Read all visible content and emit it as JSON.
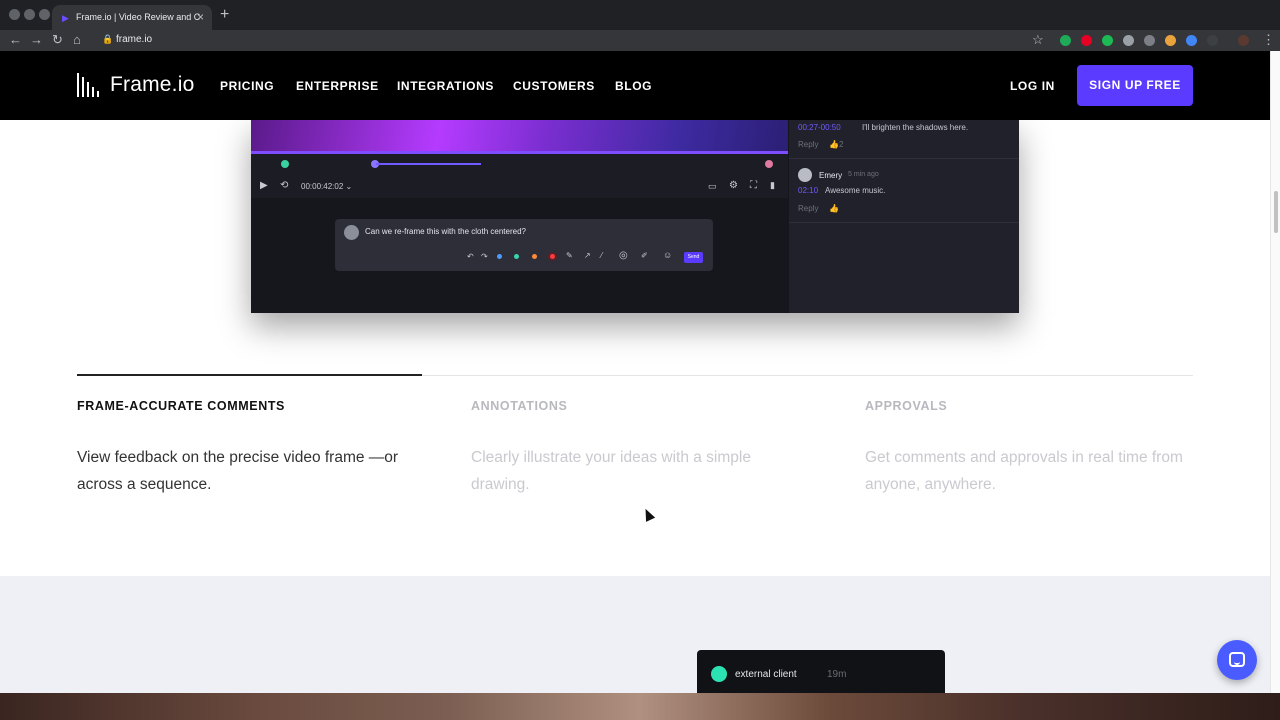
{
  "browser": {
    "tab_title": "Frame.io | Video Review and C",
    "tab_close": "×",
    "new_tab": "+",
    "url": "frame.io",
    "nav_back": "←",
    "nav_forward": "→",
    "nav_reload": "↻",
    "nav_home": "⌂",
    "lock": "🔒",
    "star": "☆",
    "menu": "⋮"
  },
  "site_nav": {
    "logo": "Frame.io",
    "links": [
      "PRICING",
      "ENTERPRISE",
      "INTEGRATIONS",
      "CUSTOMERS",
      "BLOG"
    ],
    "login": "LOG IN",
    "signup": "SIGN UP FREE"
  },
  "player": {
    "timecode": "00:00:42:02 ⌄",
    "comment_prompt": "Can we re-frame this with the cloth centered?",
    "send": "Send",
    "comments": [
      {
        "time": "00:27-00:50",
        "text": "I'll brighten the shadows here.",
        "reply": "Reply",
        "likes": "2"
      },
      {
        "author": "Emery",
        "ago": "5 min ago",
        "time": "02:10",
        "text": "Awesome music.",
        "reply": "Reply"
      }
    ]
  },
  "features": [
    {
      "title": "FRAME-ACCURATE COMMENTS",
      "desc": "View feedback on the precise video frame —or across a sequence.",
      "active": true
    },
    {
      "title": "ANNOTATIONS",
      "desc": "Clearly illustrate your ideas with a simple drawing.",
      "active": false
    },
    {
      "title": "APPROVALS",
      "desc": "Get comments and approvals in real time from anyone, anywhere.",
      "active": false
    }
  ],
  "toast": {
    "name": "external client",
    "time": "19m"
  },
  "colors": {
    "brand": "#5a3bff",
    "active_title": "#111111",
    "inactive": "#b8b8bf"
  }
}
